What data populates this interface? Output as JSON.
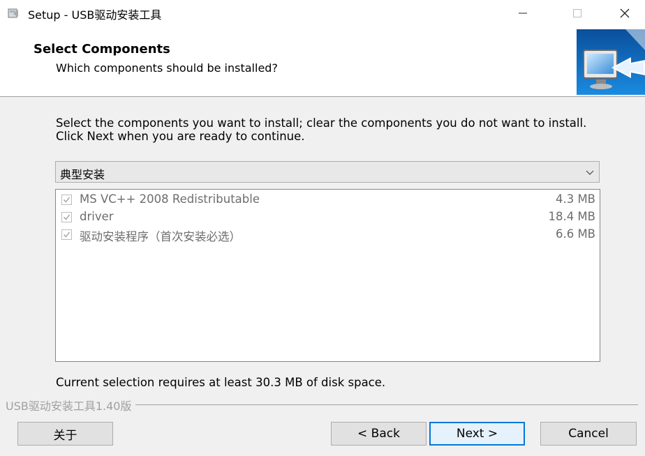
{
  "window": {
    "title": "Setup - USB驱动安装工具",
    "minimize_glyph": "—",
    "maximize_glyph": "☐",
    "close_glyph": "✕"
  },
  "header": {
    "title": "Select Components",
    "subtitle": "Which components should be installed?",
    "image_icon": "monitor-arrow-icon"
  },
  "body": {
    "description": "Select the components you want to install; clear the components you do not want to install. Click Next when you are ready to continue.",
    "setup_type": {
      "selected": "典型安装"
    },
    "components": [
      {
        "label": "MS VC++ 2008 Redistributable",
        "size": "4.3 MB",
        "checked": true
      },
      {
        "label": "driver",
        "size": "18.4 MB",
        "checked": true
      },
      {
        "label": "驱动安装程序（首次安装必选）",
        "size": "6.6 MB",
        "checked": true
      }
    ],
    "disk_space": "Current selection requires at least 30.3 MB of disk space."
  },
  "footer": {
    "version": "USB驱动安装工具1.40版",
    "about_label": "关于",
    "back_label": "< Back",
    "next_label": "Next >",
    "cancel_label": "Cancel"
  },
  "colors": {
    "window_bg": "#f0f0f0",
    "header_bg": "#ffffff",
    "default_button_border": "#0078d7"
  }
}
